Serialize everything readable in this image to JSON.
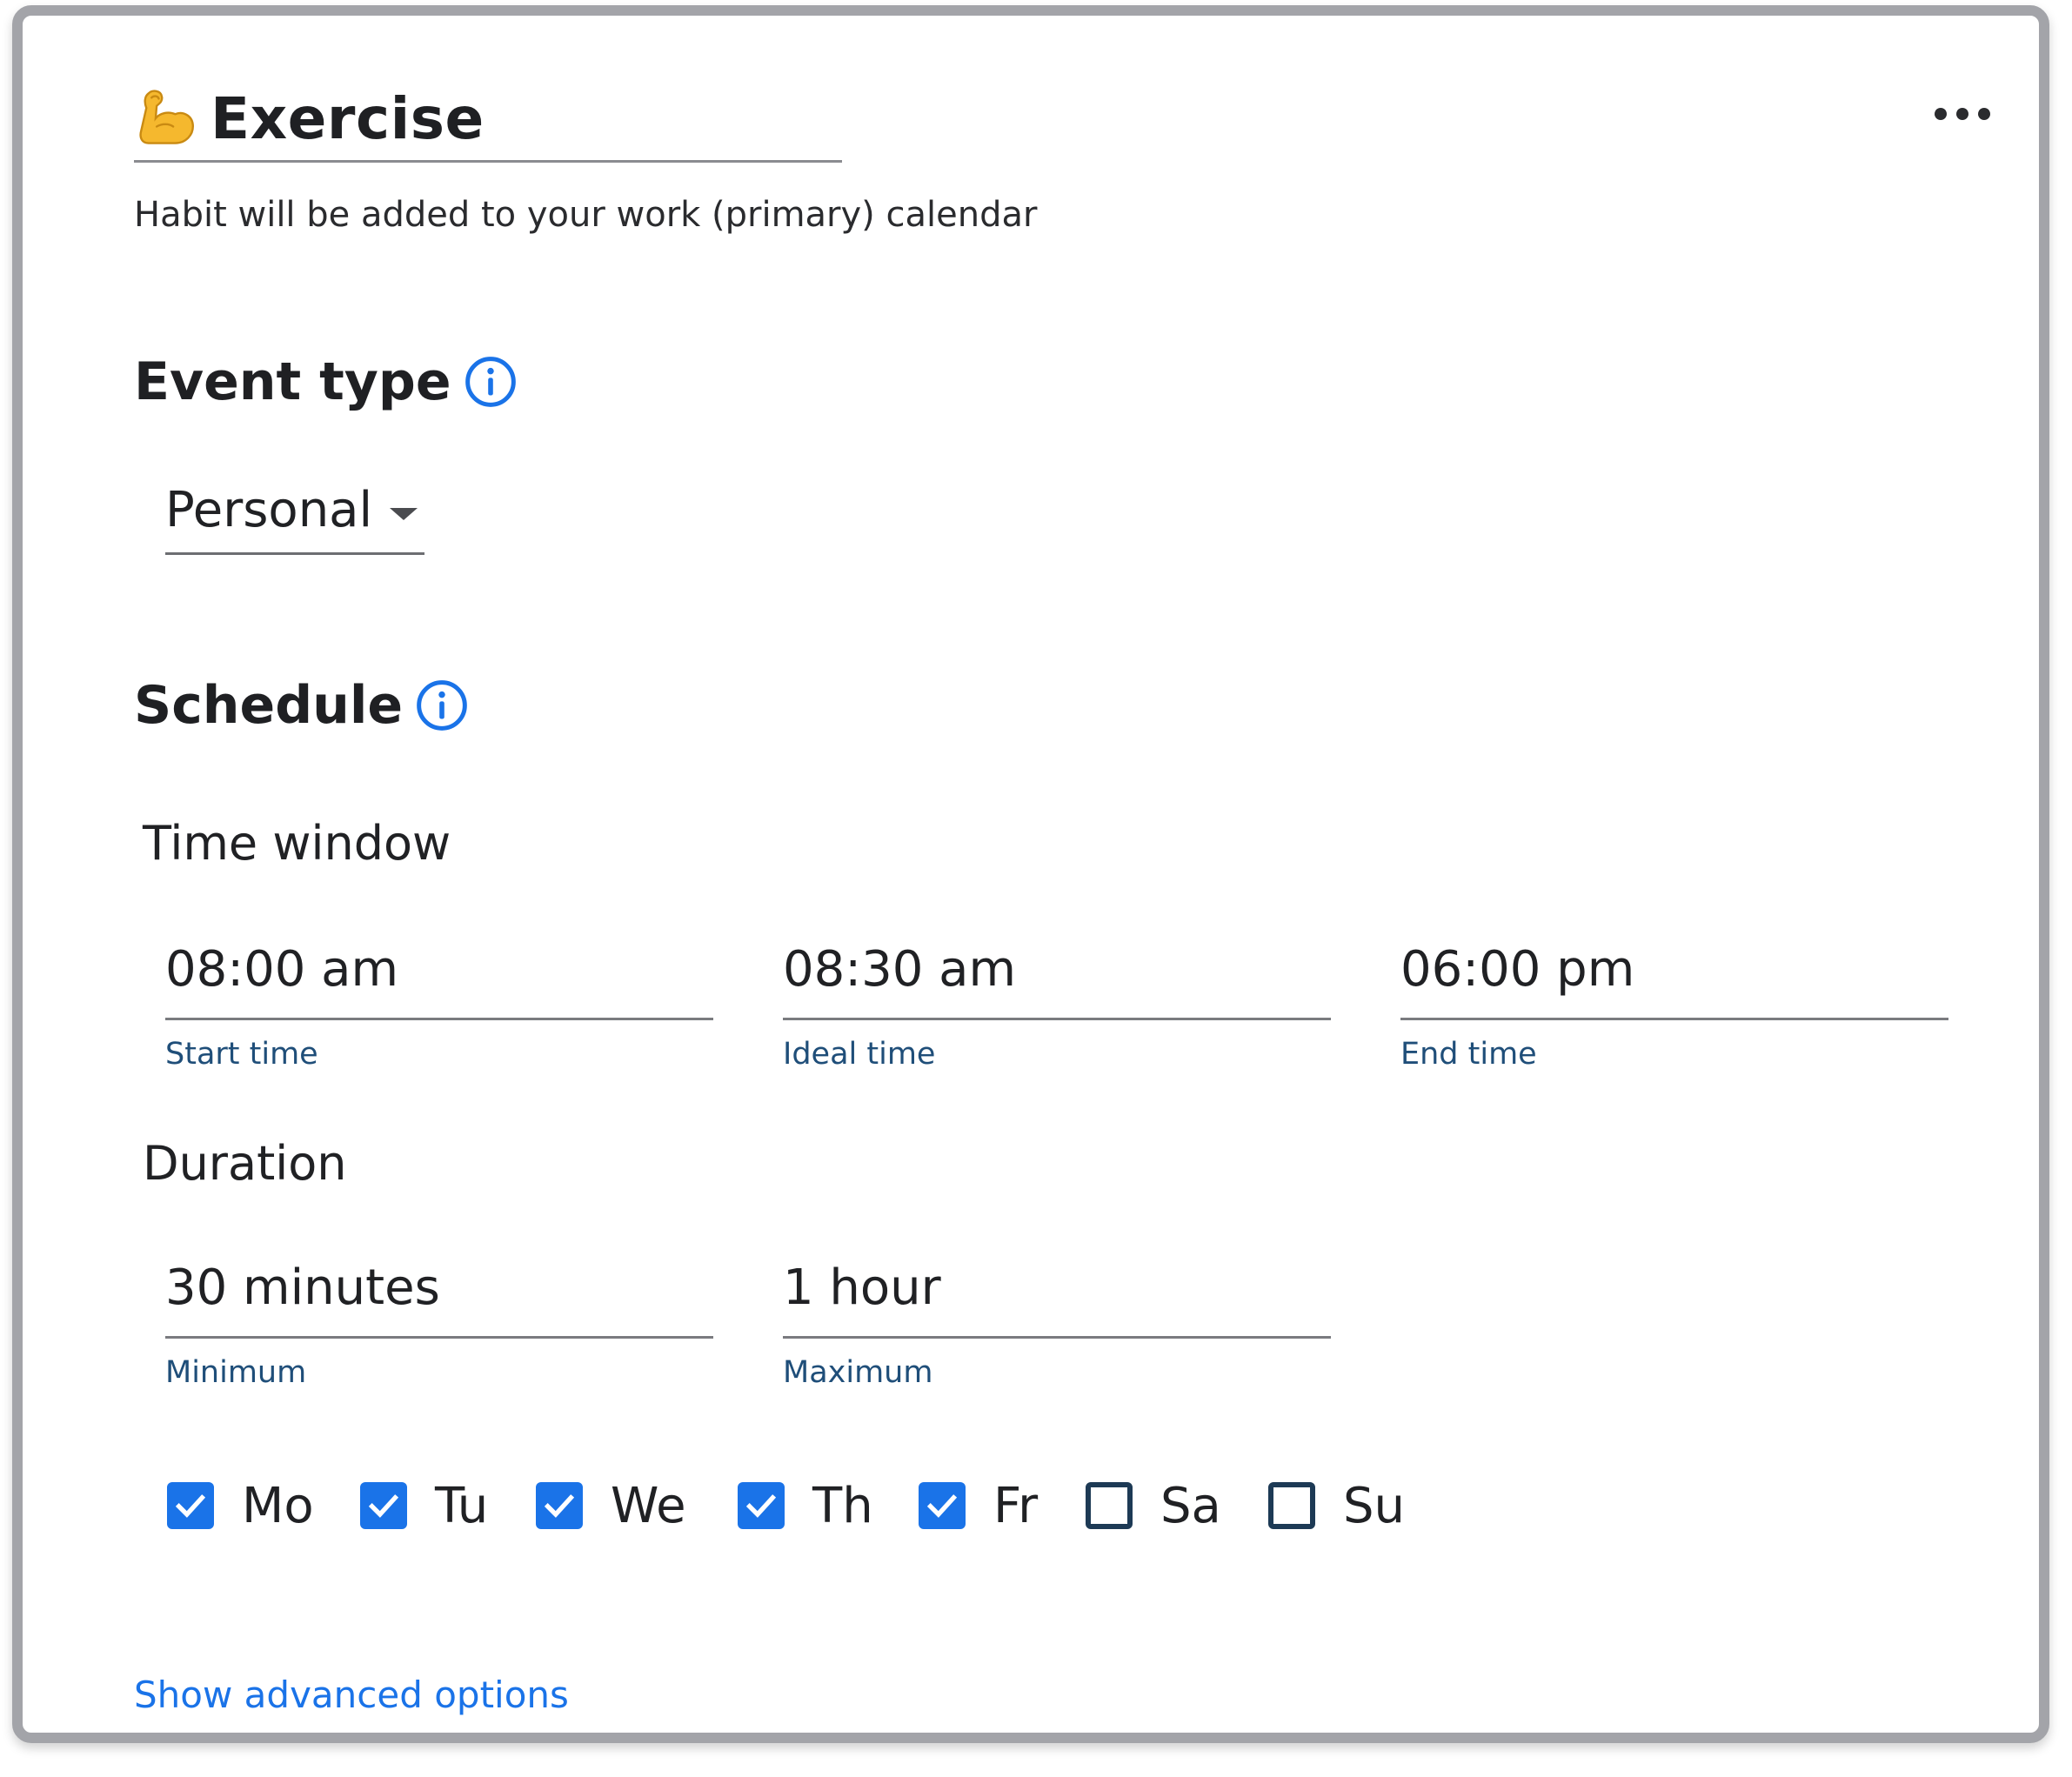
{
  "header": {
    "title_emoji": "💪",
    "title": "Exercise",
    "more_icon": "more-horizontal-icon",
    "subtitle": "Habit will be added to your work (primary) calendar"
  },
  "event_type": {
    "heading": "Event type",
    "info_icon": "info-icon",
    "selected": "Personal"
  },
  "schedule": {
    "heading": "Schedule",
    "info_icon": "info-icon",
    "time_window": {
      "label": "Time window",
      "start": {
        "value": "08:00 am",
        "helper": "Start time"
      },
      "ideal": {
        "value": "08:30 am",
        "helper": "Ideal time"
      },
      "end": {
        "value": "06:00 pm",
        "helper": "End time"
      }
    },
    "duration": {
      "label": "Duration",
      "min": {
        "value": "30 minutes",
        "helper": "Minimum"
      },
      "max": {
        "value": "1 hour",
        "helper": "Maximum"
      }
    },
    "days": [
      {
        "label": "Mo",
        "checked": true
      },
      {
        "label": "Tu",
        "checked": true
      },
      {
        "label": "We",
        "checked": true
      },
      {
        "label": "Th",
        "checked": true
      },
      {
        "label": "Fr",
        "checked": true
      },
      {
        "label": "Sa",
        "checked": false
      },
      {
        "label": "Su",
        "checked": false
      }
    ]
  },
  "footer": {
    "advanced_link": "Show advanced options"
  },
  "colors": {
    "accent": "#1a73e8",
    "helper_text": "#1f4e79",
    "unchecked_border": "#1d3a55",
    "card_border": "#a3a4a9"
  }
}
